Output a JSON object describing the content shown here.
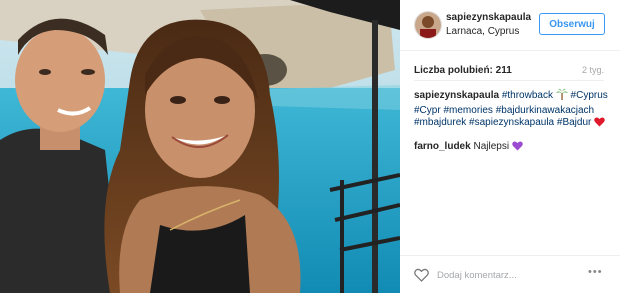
{
  "post": {
    "username": "sapiezynskapaula",
    "location": "Larnaca, Cyprus",
    "follow_label": "Obserwuj",
    "likes_label": "Liczba polubień: 211",
    "time_ago": "2 tyg.",
    "caption": {
      "username": "sapiezynskapaula",
      "tags": [
        "#throwback",
        "#Cyprus",
        "#Cypr",
        "#memories",
        "#bajdurkinawakacjach",
        "#mbajdurek",
        "#sapiezynskapaula",
        "#Bajdur"
      ],
      "emoji_palm": "palm-tree",
      "emoji_heart": "red-heart"
    },
    "comments": [
      {
        "username": "farno_ludek",
        "text": "Najlepsi",
        "emoji": "purple-heart"
      }
    ],
    "add_comment_placeholder": "Dodaj komentarz...",
    "more_label": "•••",
    "colors": {
      "link": "#003569",
      "follow": "#3897f0",
      "muted": "#a5a7aa"
    }
  }
}
